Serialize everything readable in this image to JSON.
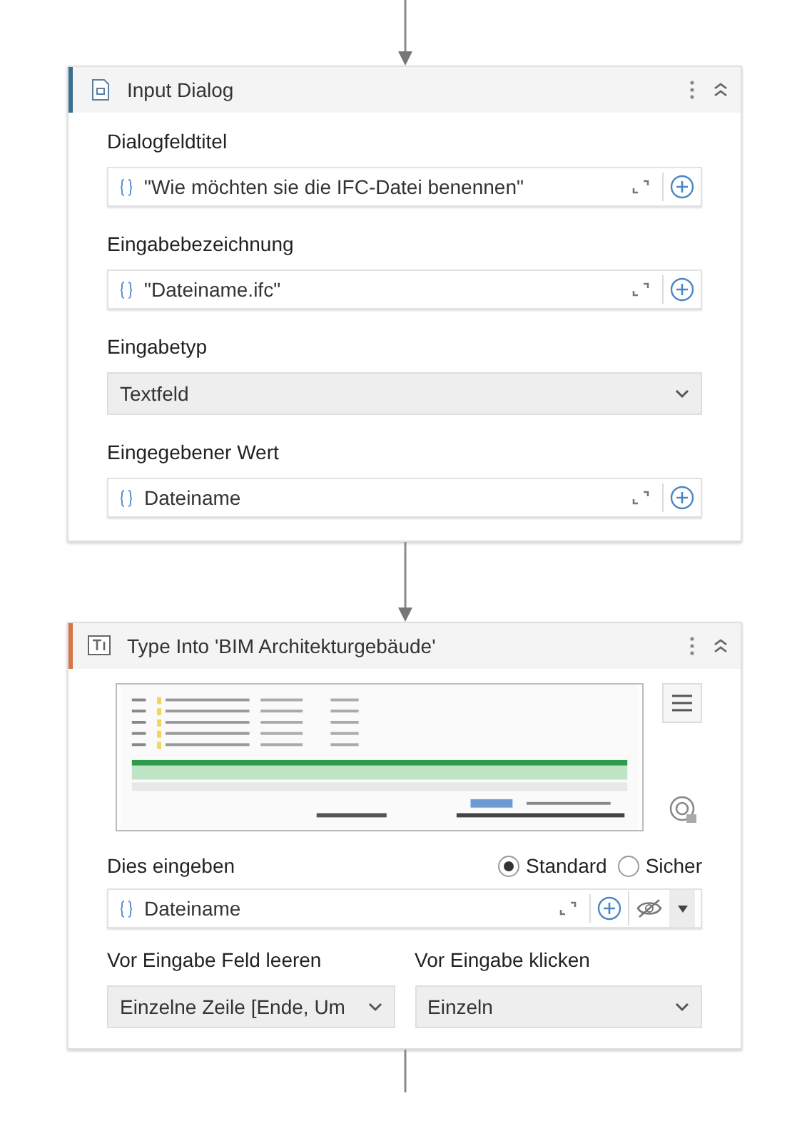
{
  "activities": [
    {
      "kind": "input_dialog",
      "title": "Input Dialog",
      "color": "#3b6e8f",
      "collapsed": false,
      "fields": [
        {
          "kind": "expression",
          "label": "Dialogfeldtitel",
          "value": "\"Wie möchten sie die IFC-Datei benennen\""
        },
        {
          "kind": "expression",
          "label": "Eingabebezeichnung",
          "value": "\"Dateiname.ifc\""
        },
        {
          "kind": "dropdown",
          "label": "Eingabetyp",
          "value": "Textfeld"
        },
        {
          "kind": "expression",
          "label": "Eingegebener Wert",
          "value": "Dateiname"
        }
      ]
    },
    {
      "kind": "type_into",
      "title": "Type Into 'BIM Architekturgebäude'",
      "color": "#d9734a",
      "collapsed": false,
      "label": "Dies eingeben",
      "options": [
        {
          "label": "Standard",
          "selected": true
        },
        {
          "label": "Sicher",
          "selected": false
        }
      ],
      "value": "Dateiname",
      "dropdowns": [
        {
          "label": "Vor Eingabe Feld leeren",
          "value": "Einzelne Zeile [Ende, Um"
        },
        {
          "label": "Vor Eingabe klicken",
          "value": "Einzeln"
        }
      ]
    }
  ]
}
